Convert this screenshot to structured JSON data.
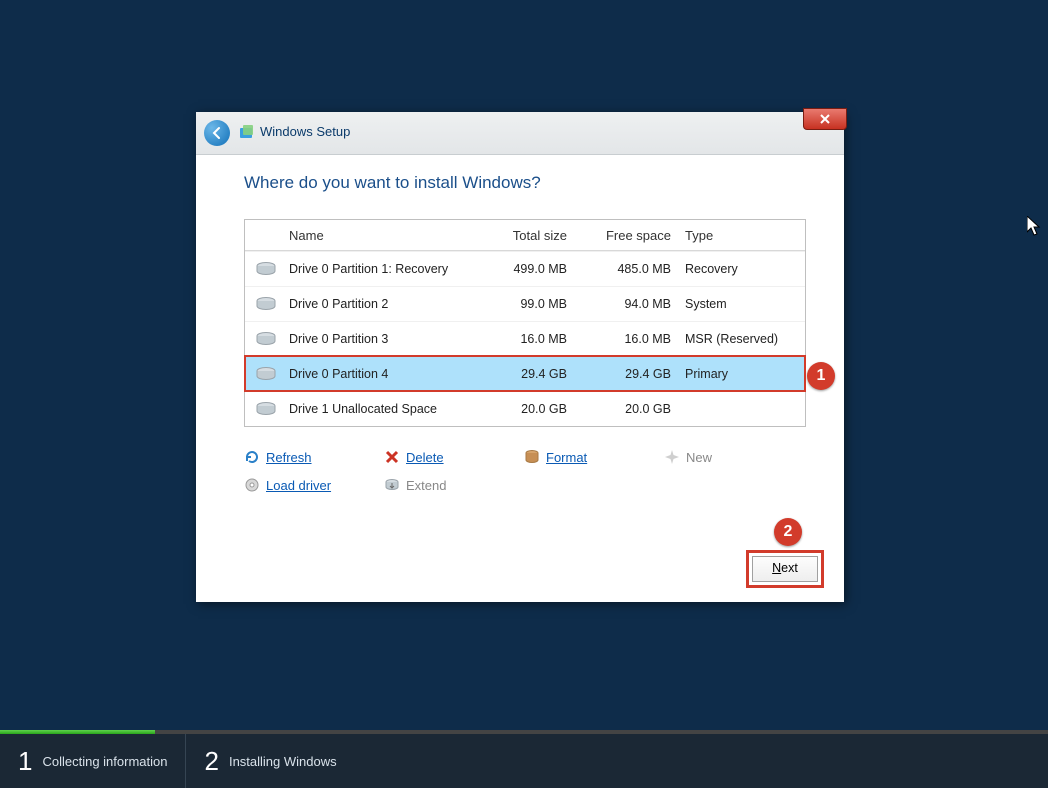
{
  "title": "Windows Setup",
  "question": "Where do you want to install Windows?",
  "table": {
    "headers": {
      "name": "Name",
      "total": "Total size",
      "free": "Free space",
      "type": "Type"
    },
    "rows": [
      {
        "name": "Drive 0 Partition 1: Recovery",
        "total": "499.0 MB",
        "free": "485.0 MB",
        "type": "Recovery",
        "selected": false
      },
      {
        "name": "Drive 0 Partition 2",
        "total": "99.0 MB",
        "free": "94.0 MB",
        "type": "System",
        "selected": false
      },
      {
        "name": "Drive 0 Partition 3",
        "total": "16.0 MB",
        "free": "16.0 MB",
        "type": "MSR (Reserved)",
        "selected": false
      },
      {
        "name": "Drive 0 Partition 4",
        "total": "29.4 GB",
        "free": "29.4 GB",
        "type": "Primary",
        "selected": true
      },
      {
        "name": "Drive 1 Unallocated Space",
        "total": "20.0 GB",
        "free": "20.0 GB",
        "type": "",
        "selected": false
      }
    ]
  },
  "actions": {
    "refresh": "Refresh",
    "delete": "Delete",
    "format": "Format",
    "new": "New",
    "load_driver": "Load driver",
    "extend": "Extend"
  },
  "next_label": "Next",
  "annotations": {
    "one": "1",
    "two": "2"
  },
  "steps": {
    "s1_num": "1",
    "s1_label": "Collecting information",
    "s2_num": "2",
    "s2_label": "Installing Windows"
  }
}
